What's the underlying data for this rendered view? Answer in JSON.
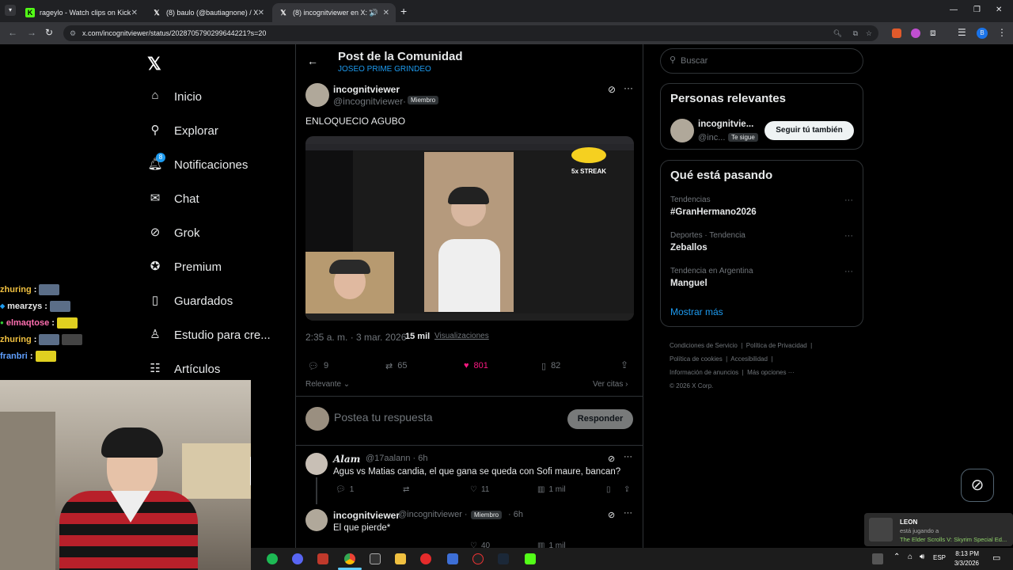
{
  "browser": {
    "tabs": [
      {
        "label": "rageylo - Watch clips on Kick",
        "icon": "kick-icon"
      },
      {
        "label": "(8) baulo (@bautiagnone) / X",
        "icon": "x-icon"
      },
      {
        "label": "(8) incognitviewer en X: \"EN",
        "icon": "x-icon"
      }
    ],
    "url": "x.com/incognitviewer/status/2028705790299644221?s=20"
  },
  "nav": {
    "items": [
      {
        "label": "Inicio",
        "icon": "home-icon"
      },
      {
        "label": "Explorar",
        "icon": "search-icon"
      },
      {
        "label": "Notificaciones",
        "icon": "bell-icon",
        "badge": "8"
      },
      {
        "label": "Chat",
        "icon": "mail-icon"
      },
      {
        "label": "Grok",
        "icon": "grok-icon"
      },
      {
        "label": "Premium",
        "icon": "verified-icon"
      },
      {
        "label": "Guardados",
        "icon": "bookmark-icon"
      },
      {
        "label": "Estudio para cre...",
        "icon": "studio-icon"
      },
      {
        "label": "Artículos",
        "icon": "article-icon"
      }
    ]
  },
  "header": {
    "title": "Post de la Comunidad",
    "community": "JOSEO PRIME GRINDEO"
  },
  "post": {
    "author_name": "incognitviewer",
    "author_handle": "@incognitviewer",
    "member_badge": "Miembro",
    "text": "ENLOQUECIO AGUBO",
    "image_overlay": "5x STREAK",
    "time": "2:35 a. m. · 3 mar. 2026 ·",
    "views_count": "15 mil",
    "views_label": "Visualizaciones",
    "replies": "9",
    "reposts": "65",
    "likes": "801",
    "bookmarks": "82",
    "sort_label": "Relevante",
    "quotes_label": "Ver citas"
  },
  "reply_box": {
    "placeholder": "Postea tu respuesta",
    "button": "Responder"
  },
  "replies": [
    {
      "name": "𝑨𝒍𝒂𝒎",
      "handle": "@17aalann · 6h",
      "text": "Agus vs Matias candia, el que gana se queda con Sofi maure, bancan?",
      "replies": "1",
      "likes": "11",
      "views": "1 mil"
    },
    {
      "name": "incognitviewer",
      "handle": "@incognitviewer ·",
      "badge": "Miembro",
      "time": "· 6h",
      "text": "El que pierde*",
      "likes": "40",
      "views": "1 mil"
    }
  ],
  "search": {
    "placeholder": "Buscar"
  },
  "relevant": {
    "title": "Personas relevantes",
    "name": "incognitvie...",
    "handle": "@inc...",
    "follows_you": "Te sigue",
    "follow_button": "Seguir tú también"
  },
  "trends": {
    "title": "Qué está pasando",
    "items": [
      {
        "context": "Tendencias",
        "name": "#GranHermano2026"
      },
      {
        "context": "Deportes · Tendencia",
        "name": "Zeballos"
      },
      {
        "context": "Tendencia en Argentina",
        "name": "Manguel"
      }
    ],
    "show_more": "Mostrar más"
  },
  "footer": {
    "links": [
      "Condiciones de Servicio",
      "Política de Privacidad",
      "Política de cookies",
      "Accesibilidad",
      "Información de anuncios",
      "Más opciones ···"
    ],
    "copyright": "© 2026 X Corp."
  },
  "stream_chat": [
    {
      "user": "zhuring",
      "color": "#f0c040"
    },
    {
      "user": "mearzys",
      "color": "#e8e8e8"
    },
    {
      "user": "elmaqtose",
      "color": "#ff6fb0"
    },
    {
      "user": "zhuring",
      "color": "#f0c040"
    },
    {
      "user": "franbri",
      "color": "#60a0ff"
    }
  ],
  "toast": {
    "name": "LEON",
    "line1": "está jugando a",
    "game": "The Elder Scrolls V: Skyrim Special Ed..."
  },
  "clock": {
    "time": "8:13 PM",
    "date": "3/3/2026",
    "lang": "ESP"
  },
  "colors": {
    "like": "#f91880",
    "link": "#1d9bf0",
    "border": "#2f3336"
  }
}
